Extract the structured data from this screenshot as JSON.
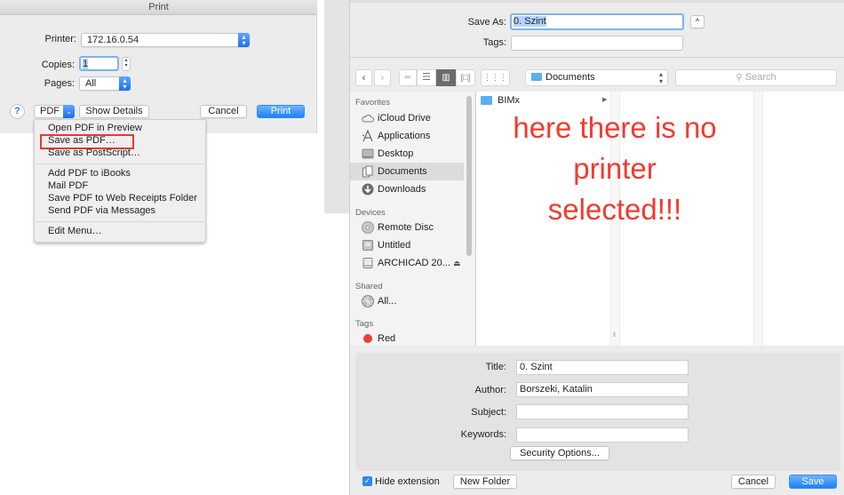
{
  "print_dialog": {
    "title": "Print",
    "printer_label": "Printer:",
    "printer_value": "172.16.0.54",
    "copies_label": "Copies:",
    "copies_value": "1",
    "pages_label": "Pages:",
    "pages_value": "All",
    "help_label": "?",
    "pdf_label": "PDF",
    "show_details_label": "Show Details",
    "cancel_label": "Cancel",
    "print_label": "Print",
    "accent_color": "#1a82fb"
  },
  "pdf_menu": {
    "groups": [
      [
        "Open PDF in Preview",
        "Save as PDF…",
        "Save as PostScript…"
      ],
      [
        "Add PDF to iBooks",
        "Mail PDF",
        "Save PDF to Web Receipts Folder",
        "Send PDF via Messages"
      ],
      [
        "Edit Menu…"
      ]
    ],
    "highlighted_item": "Save as PDF…",
    "highlight_color": "#e53b2f"
  },
  "save_dialog": {
    "save_as_label": "Save As:",
    "save_as_value": "0. Szint",
    "tags_label": "Tags:",
    "tags_value": "",
    "location": "Documents",
    "search_placeholder": "Search",
    "sidebar": {
      "favorites_heading": "Favorites",
      "favorites": [
        {
          "label": "iCloud Drive",
          "icon": "cloud-icon"
        },
        {
          "label": "Applications",
          "icon": "applications-icon"
        },
        {
          "label": "Desktop",
          "icon": "desktop-icon"
        },
        {
          "label": "Documents",
          "icon": "documents-icon",
          "selected": true
        },
        {
          "label": "Downloads",
          "icon": "downloads-icon"
        }
      ],
      "devices_heading": "Devices",
      "devices": [
        {
          "label": "Remote Disc",
          "icon": "disc-icon"
        },
        {
          "label": "Untitled",
          "icon": "drive-icon"
        },
        {
          "label": "ARCHICAD 20...",
          "icon": "drive-icon",
          "eject": true
        }
      ],
      "shared_heading": "Shared",
      "shared": [
        {
          "label": "All...",
          "icon": "network-icon"
        }
      ],
      "tags_heading": "Tags",
      "tags": [
        {
          "label": "Red",
          "color": "#f03b35"
        }
      ]
    },
    "files": [
      {
        "name": "BIMx",
        "type": "folder"
      }
    ],
    "annotation_line1": "here there is no",
    "annotation_line2": "printer selected!!!",
    "annotation_color": "#f03b2f",
    "metadata": {
      "title_label": "Title:",
      "title_value": "0. Szint",
      "author_label": "Author:",
      "author_value": "Borszeki, Katalin",
      "subject_label": "Subject:",
      "subject_value": "",
      "keywords_label": "Keywords:",
      "keywords_value": "",
      "security_button": "Security Options..."
    },
    "hide_extension_label": "Hide extension",
    "hide_extension_checked": true,
    "new_folder_label": "New Folder",
    "cancel_label": "Cancel",
    "save_label": "Save"
  }
}
